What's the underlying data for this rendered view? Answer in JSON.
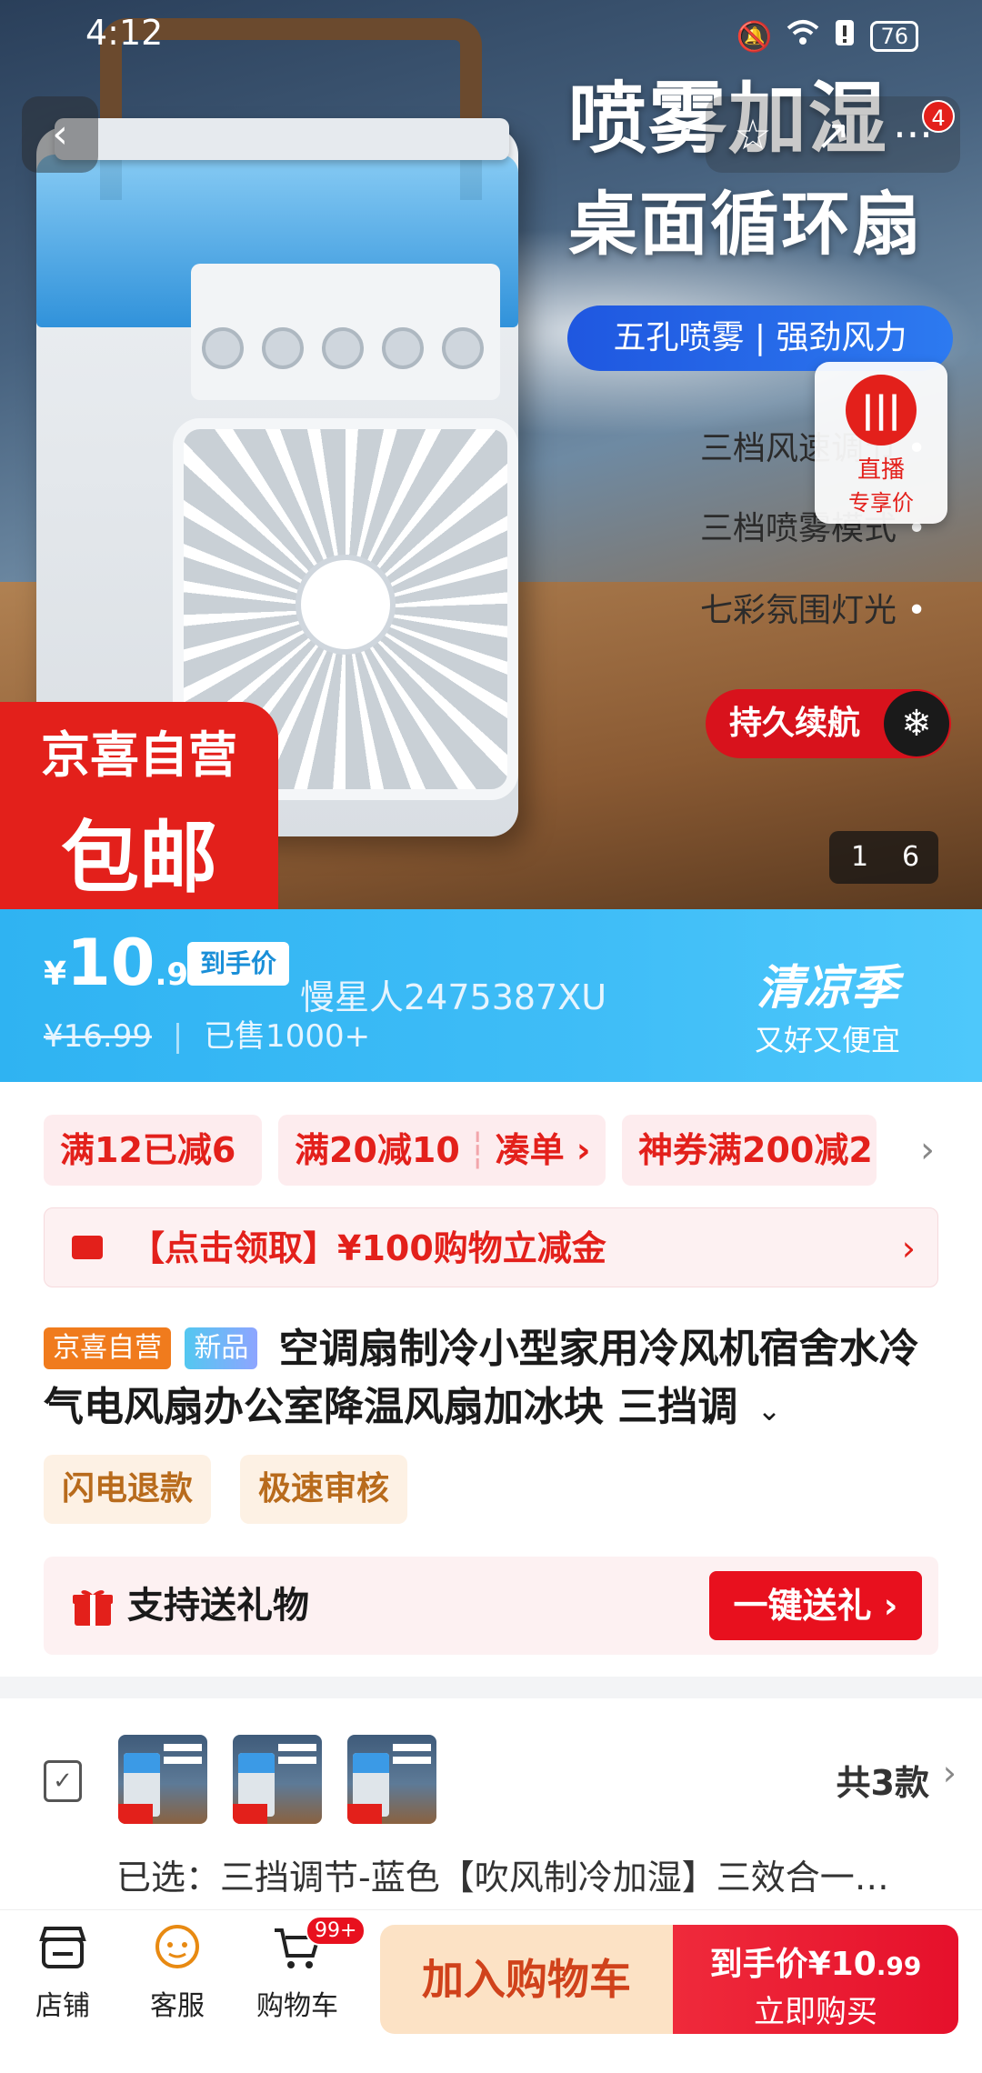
{
  "status_bar": {
    "time": "4:12",
    "battery": "76"
  },
  "nav": {
    "message_count": "4"
  },
  "hero": {
    "headline1": "喷雾加湿",
    "headline2": "桌面循环扇",
    "pill": "五孔喷雾 | 强劲风力",
    "features": [
      "三档风速调节",
      "三档喷雾模式",
      "七彩氛围灯光"
    ],
    "endurance": "持久续航",
    "promo_line1": "京喜自营",
    "promo_line2": "包邮",
    "image_index": "1",
    "image_total": "6",
    "live_label": "直播",
    "live_sub": "专享价"
  },
  "price": {
    "currency": "¥",
    "integer": "10",
    "decimal": ".99",
    "arrival_tag": "到手价",
    "watermark": "慢星人2475387XU",
    "original": "¥16.99",
    "sold": "已售1000+",
    "season_title": "清凉季",
    "season_sub": "又好又便宜"
  },
  "coupons": [
    {
      "text": "满12已减6"
    },
    {
      "text": "满20减10",
      "extra": "凑单 ›"
    },
    {
      "text": "神券满200减2"
    }
  ],
  "cash_bar": {
    "text": "【点击领取】¥100购物立减金"
  },
  "product": {
    "tag_self": "京喜自营",
    "tag_new": "新品",
    "title": "空调扇制冷小型家用冷风机宿舍水冷气电风扇办公室降温风扇加冰块 三挡调"
  },
  "services": [
    "闪电退款",
    "极速审核"
  ],
  "gift": {
    "text": "支持送礼物",
    "button": "一键送礼 ›"
  },
  "variants": {
    "count": "共3款",
    "selected_prefix": "已选：",
    "selected": "三挡调节-蓝色【吹风制冷加湿】三效合一…"
  },
  "bottom_bar": {
    "store": "店铺",
    "service": "客服",
    "cart": "购物车",
    "cart_badge": "99+",
    "add_cart": "加入购物车",
    "buy_price_label": "到手价",
    "buy_price_int": "¥10",
    "buy_price_dec": ".99",
    "buy_label": "立即购买"
  },
  "colors": {
    "brand_red": "#e3201b",
    "banner_blue": "#2fb3f2",
    "self_tag": "#f07b1d"
  }
}
